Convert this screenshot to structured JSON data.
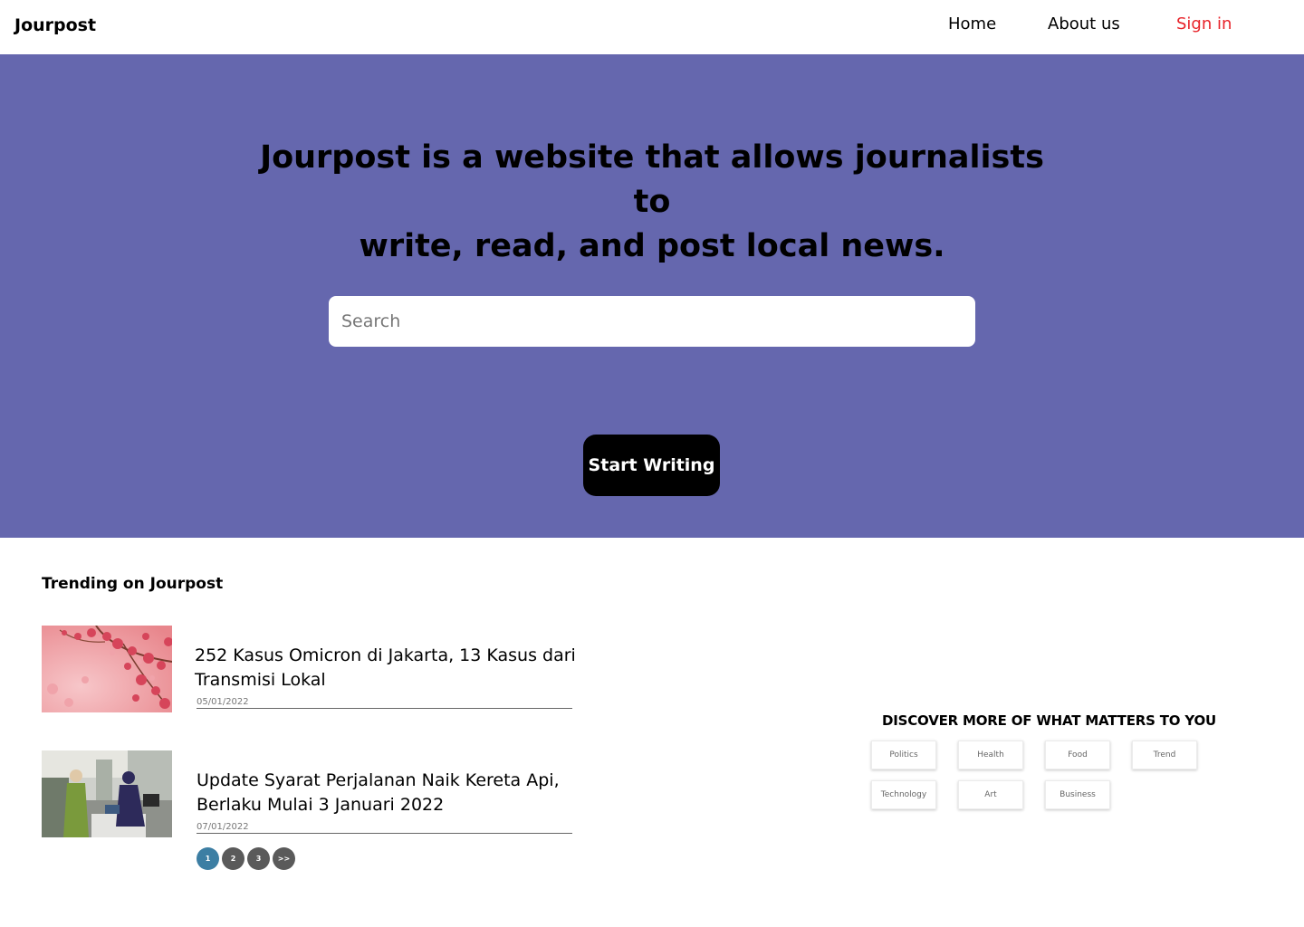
{
  "header": {
    "brand": "Jourpost",
    "nav": {
      "home": "Home",
      "about": "About us",
      "signin": "Sign in"
    },
    "signin_color": "#e8232a"
  },
  "hero": {
    "title_line1": "Jourpost is a website that allows journalists to",
    "title_line2": "write, read, and post local news.",
    "search_placeholder": "Search",
    "start_label": "Start Writing",
    "background": "#6567ae"
  },
  "trending": {
    "heading": "Trending on Jourpost",
    "articles": [
      {
        "title": "252 Kasus Omicron di Jakarta, 13 Kasus dari Transmisi Lokal",
        "date": "05/01/2022",
        "image": "pink-blossom-photo"
      },
      {
        "title": "Update Syarat Perjalanan Naik Kereta Api, Berlaku Mulai 3 Januari 2022",
        "date": "07/01/2022",
        "image": "station-counter-photo"
      }
    ],
    "pagination": {
      "pages": [
        "1",
        "2",
        "3"
      ],
      "next": ">>",
      "current": "1"
    }
  },
  "discover": {
    "title": "DISCOVER MORE OF WHAT MATTERS TO YOU",
    "tags": [
      "Politics",
      "Health",
      "Food",
      "Trend",
      "Technology",
      "Art",
      "Business"
    ]
  }
}
